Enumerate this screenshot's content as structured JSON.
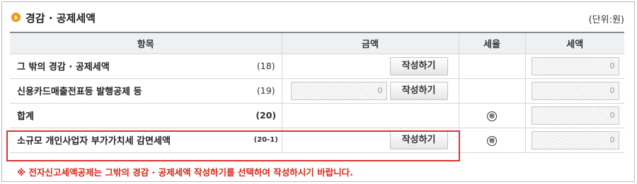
{
  "section": {
    "title": "경감 · 공제세액",
    "unit": "(단위:원)"
  },
  "table": {
    "headers": {
      "item": "항목",
      "amount": "금액",
      "rate": "세율",
      "tax": "세액"
    },
    "rows": [
      {
        "label": "그 밖의 경감 · 공제세액",
        "code": "(18)",
        "amount_value": "",
        "button": "작성하기",
        "rate": "",
        "tax_value": "0"
      },
      {
        "label": "신용카드매출전표등 발행공제 등",
        "code": "(19)",
        "amount_value": "0",
        "button": "작성하기",
        "rate": "",
        "tax_value": "0"
      },
      {
        "label": "합계",
        "code": "(20)",
        "amount_value": "",
        "button": "",
        "rate": "㉳",
        "tax_value": "0"
      },
      {
        "label": "소규모 개인사업자 부가가치세 감면세액",
        "code": "(20-1)",
        "amount_value": "",
        "button": "작성하기",
        "rate": "㉳",
        "tax_value": "0"
      }
    ]
  },
  "note": "※ 전자신고세액공제는 그밖의 경감 · 공제세액 작성하기를 선택하여 작성하시기 바랍니다.",
  "colors": {
    "accent_bullet": "#f0a020",
    "highlight_border": "#e03030",
    "note_text": "#d9281a",
    "header_bg": "#eef0f4"
  }
}
